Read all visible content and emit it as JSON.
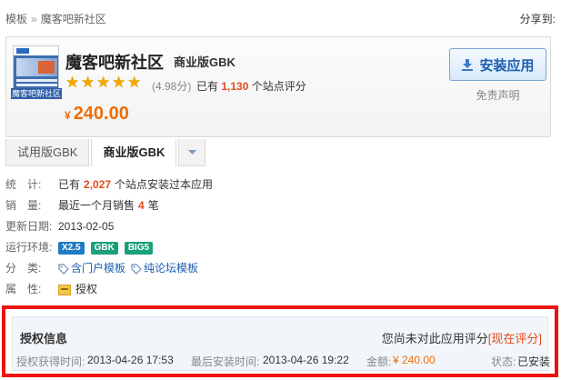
{
  "breadcrumb": {
    "root": "模板",
    "separator": "»",
    "current": "魔客吧新社区"
  },
  "share_label": "分享到:",
  "app": {
    "thumbnail_caption": "魔客吧新社区",
    "name": "魔客吧新社区",
    "edition": "商业版GBK",
    "stars": 5,
    "rating": "(4.98分)",
    "rating_prefix": "已有",
    "rating_count": "1,130",
    "rating_suffix": "个站点评分",
    "price_currency": "¥",
    "price": "240.00",
    "install_label": "安装应用",
    "disclaimer": "免责声明"
  },
  "tabs": [
    {
      "label": "试用版GBK",
      "active": false
    },
    {
      "label": "商业版GBK",
      "active": true
    }
  ],
  "info": {
    "stats_label": "统　计:",
    "stats_prefix": "已有",
    "stats_count": "2,027",
    "stats_suffix": "个站点安装过本应用",
    "sales_label": "销　量:",
    "sales_prefix": "最近一个月销售",
    "sales_count": "4",
    "sales_suffix": "笔",
    "updated_label": "更新日期:",
    "updated_value": "2013-02-05",
    "env_label": "运行环境:",
    "env_badges": [
      "X2.5",
      "GBK",
      "BIG5"
    ],
    "category_label": "分　类:",
    "categories": [
      "含门户模板",
      "纯论坛模板"
    ],
    "attr_label": "属　性:",
    "attr_value": "授权"
  },
  "license": {
    "title": "授权信息",
    "rate_prompt": "您尚未对此应用评分",
    "rate_link": "[现在评分]",
    "obtained_label": "授权获得时间:",
    "obtained_value": "2013-04-26 17:53",
    "last_install_label": "最后安装时间:",
    "last_install_value": "2013-04-26 19:22",
    "amount_label": "金额:",
    "amount_value": "¥ 240.00",
    "status_label": "状态:",
    "status_value": "已安装"
  },
  "colors": {
    "accent_orange": "#f06d05",
    "link_blue": "#1d5fb0",
    "highlight_red": "#ee1111",
    "count_red": "#e04b1a"
  }
}
